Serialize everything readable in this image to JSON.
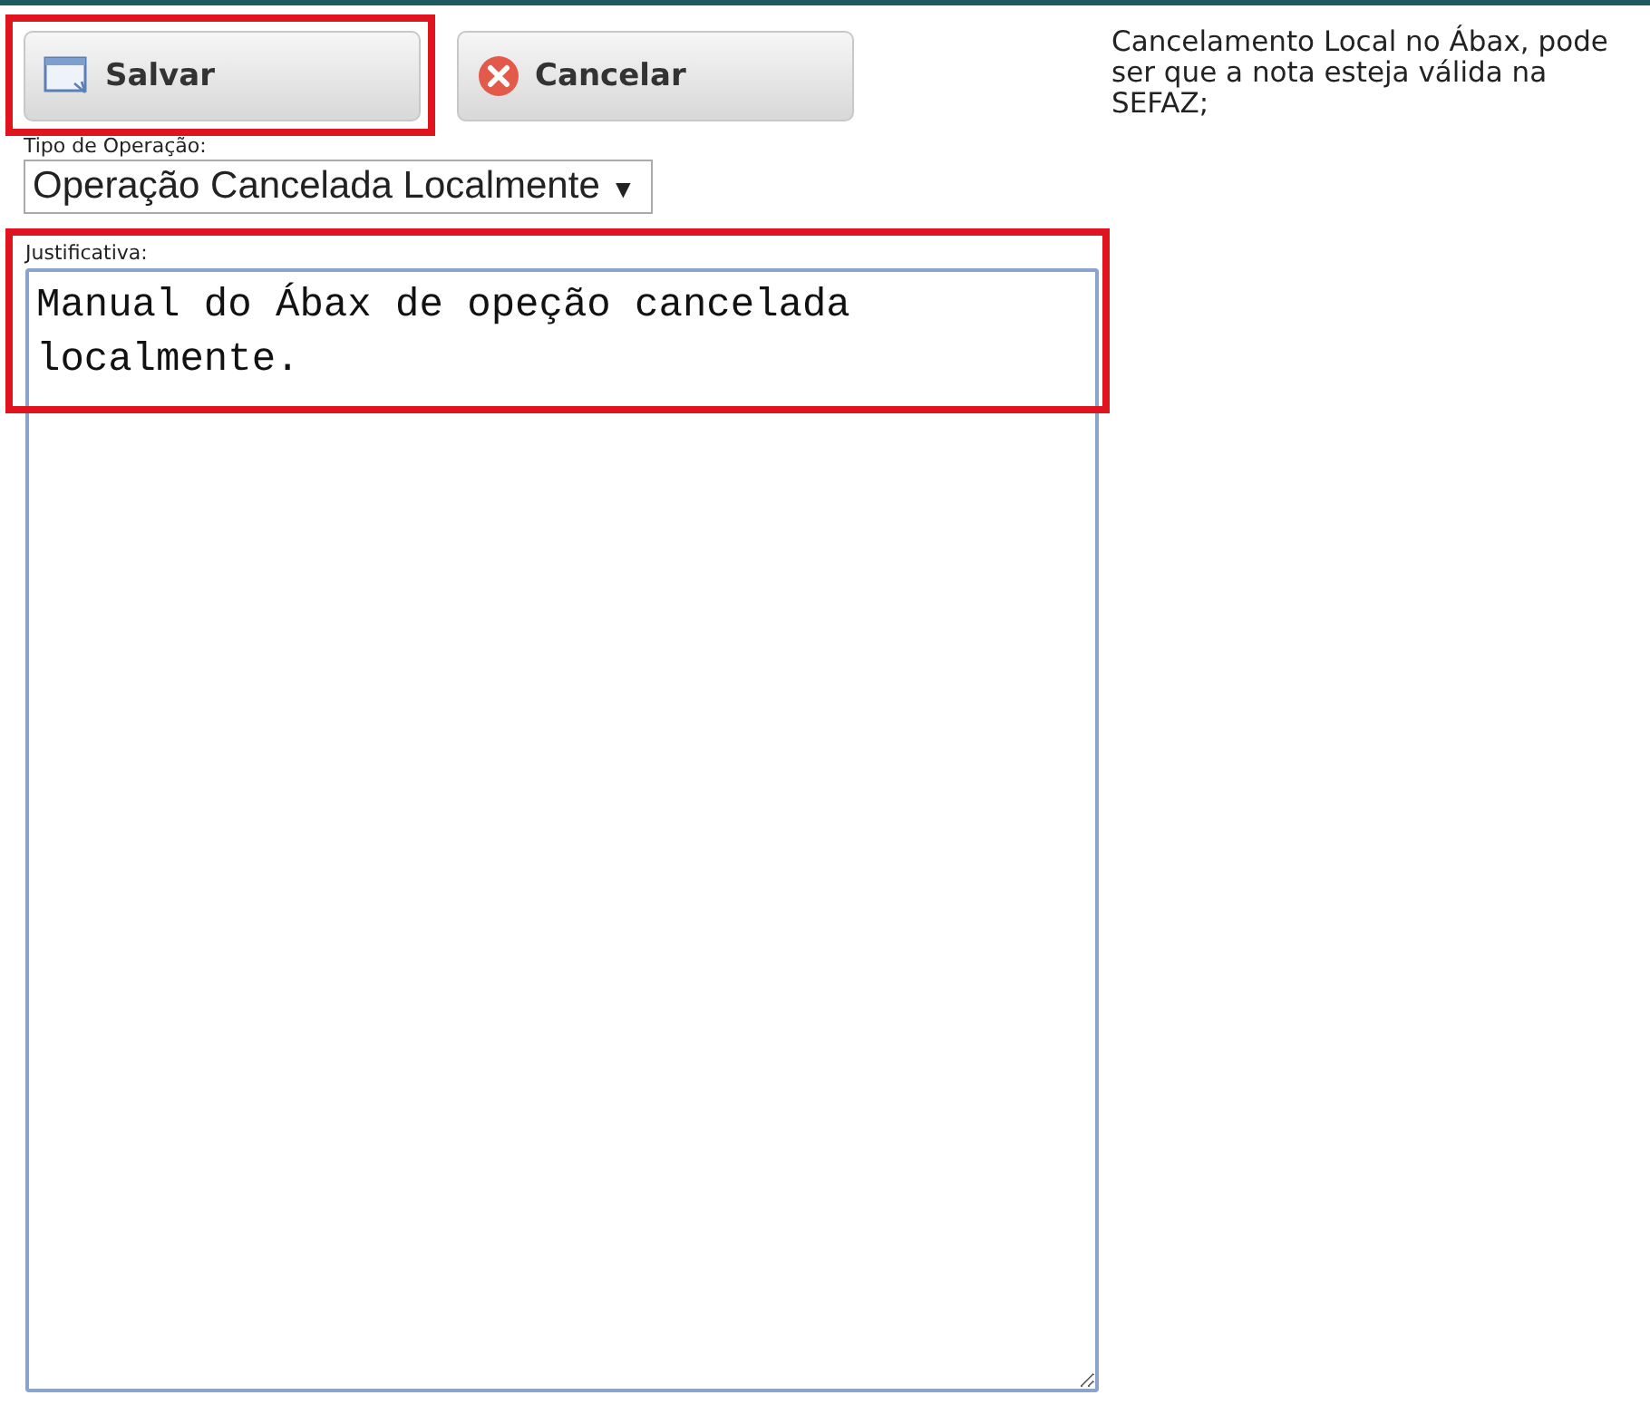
{
  "toolbar": {
    "buttons": [
      {
        "label": "Salvar",
        "kind": "save",
        "highlighted": true
      },
      {
        "label": "Cancelar",
        "kind": "cancel",
        "highlighted": false
      }
    ]
  },
  "operation_type": {
    "label": "Tipo de Operação:",
    "value": "Operação Cancelada Localmente",
    "caret": "▼"
  },
  "justification": {
    "label": "Justificativa:",
    "value": "Manual do Ábax de opeção cancelada localmente.",
    "highlighted": true
  },
  "note": "Cancelamento Local no Ábax, pode ser que a nota esteja válida na SEFAZ;"
}
